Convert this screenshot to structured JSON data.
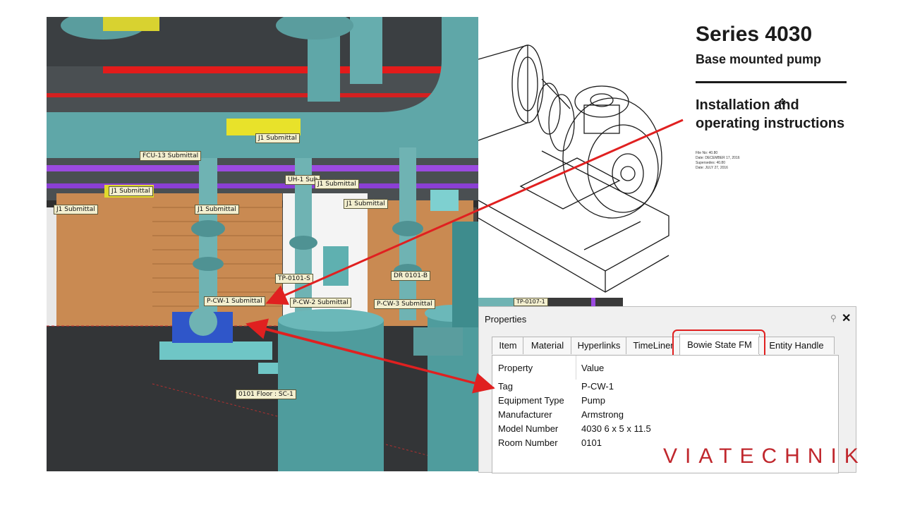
{
  "viewport": {
    "labels": {
      "j1_a": "J1 Submittal",
      "fcu13": "FCU-13 Submittal",
      "uh1": "UH-1 Sub",
      "j1_b": "J1 Submittal",
      "j1_c": "J1 Submittal",
      "j1_d": "J1 Submittal",
      "j1_e": "J1 Submittal",
      "j1_f": "J1 Submittal",
      "tp0101": "TP-0101-S",
      "dr0101": "DR 0101-B",
      "pcw1": "P-CW-1 Submittal",
      "pcw2": "P-CW-2 Submittal",
      "pcw3": "P-CW-3 Submittal",
      "floor": "0101 Floor : SC-1",
      "tp0107": "TP-0107-1"
    }
  },
  "document": {
    "title": "Series 4030",
    "subtitle": "Base mounted pump",
    "instructions": "Installation and operating instructions",
    "meta": [
      "File No: 40.80",
      "Date: DECEMBER 17, 2016",
      "Supersedes: 40.80",
      "Date: JULY 27, 2016"
    ]
  },
  "properties": {
    "title": "Properties",
    "tabs": [
      "Item",
      "Material",
      "Hyperlinks",
      "TimeLiner",
      "Bowie State FM",
      "Entity Handle"
    ],
    "active_tab": "Bowie State FM",
    "header": {
      "key": "Property",
      "value": "Value"
    },
    "rows": [
      {
        "key": "Tag",
        "value": "P-CW-1"
      },
      {
        "key": "Equipment Type",
        "value": "Pump"
      },
      {
        "key": "Manufacturer",
        "value": "Armstrong"
      },
      {
        "key": "Model Number",
        "value": "4030 6 x 5 x 11.5"
      },
      {
        "key": "Room Number",
        "value": "0101"
      }
    ]
  },
  "brand": {
    "logo": "VIATECHNIK",
    "color": "#c0272d"
  },
  "colors": {
    "annotation": "#e02020",
    "pipe": "#5fb8b8",
    "highlight": "#e02020"
  }
}
